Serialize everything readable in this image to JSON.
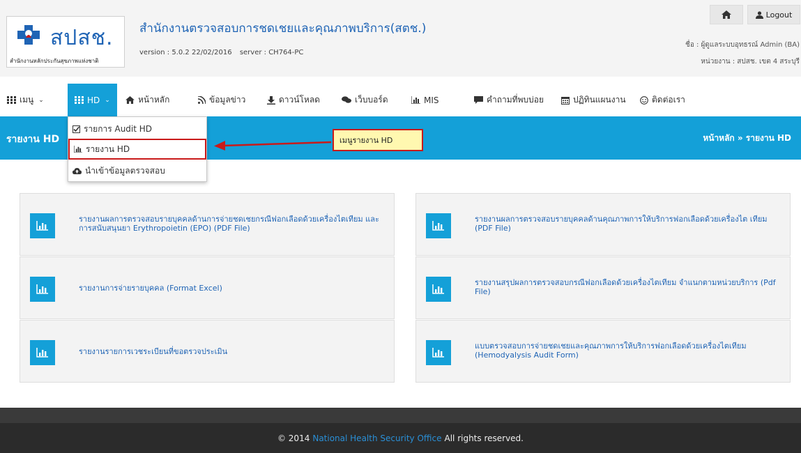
{
  "header": {
    "logo_text": "สปสช.",
    "logo_subtitle": "สำนักงานหลักประกันสุขภาพแห่งชาติ",
    "org_title": "สำนักงานตรวจสอบการชดเชยและคุณภาพบริการ(สตช.)",
    "version": "version : 5.0.2 22/02/2016",
    "server": "server : CH764-PC",
    "home_icon": "home-icon",
    "logout_label": "Logout",
    "user_name": "ชื่อ : ผู้ดูแลระบบอุทธรณ์ Admin (BA)",
    "user_unit": "หน่วยงาน : สปสช. เขต 4 สระบุรี"
  },
  "nav": {
    "items": [
      {
        "label": "เมนู",
        "icon": "grid-icon"
      },
      {
        "label": "HD",
        "icon": "grid-icon"
      },
      {
        "label": "หน้าหลัก",
        "icon": "home-icon"
      },
      {
        "label": "ข้อมูลข่าว",
        "icon": "rss-icon"
      },
      {
        "label": "ดาวน์โหลด",
        "icon": "download-icon"
      },
      {
        "label": "เว็บบอร์ด",
        "icon": "comments-icon"
      },
      {
        "label": "MIS",
        "icon": "bar-chart-icon"
      },
      {
        "label": "คำถามที่พบบ่อย",
        "icon": "comment-icon"
      },
      {
        "label": "ปฏิทินแผนงาน",
        "icon": "calendar-icon"
      },
      {
        "label": "ติดต่อเรา",
        "icon": "smile-icon"
      }
    ]
  },
  "page": {
    "title": "รายงาน HD",
    "breadcrumb": "หน้าหลัก » รายงาน HD"
  },
  "dropdown": {
    "items": [
      {
        "label": "รายการ Audit HD",
        "icon": "check-square-icon"
      },
      {
        "label": "รายงาน HD",
        "icon": "bar-chart-icon"
      },
      {
        "label": "นำเข้าข้อมูลตรวจสอบ",
        "icon": "cloud-upload-icon"
      }
    ]
  },
  "annotation": {
    "callout": "เมนูรายงาน HD"
  },
  "cards": [
    {
      "text": "รายงานผลการตรวจสอบรายบุคคลด้านการจ่ายชดเชยกรณีฟอกเลือดด้วยเครื่องไตเทียม และการสนับสนุนยา Erythropoietin (EPO) (PDF File)"
    },
    {
      "text": "รายงานผลการตรวจสอบรายบุคคลด้านคุณภาพการให้บริการฟอกเลือดด้วยเครื่องไต เทียม (PDF File)"
    },
    {
      "text": "รายงานการจ่ายรายบุคคล (Format Excel)"
    },
    {
      "text": "รายงานสรุปผลการตรวจสอบกรณีฟอกเลือดด้วยเครื่องไตเทียม จำแนกตามหน่วยบริการ (Pdf File)"
    },
    {
      "text": "รายงานรายการเวชระเบียนที่ขอตรวจประเมิน"
    },
    {
      "text": "แบบตรวจสอบการจ่ายชดเชยและคุณภาพการให้บริการฟอกเลือดด้วยเครื่องไตเทียม (Hemodyalysis Audit Form)"
    }
  ],
  "footer": {
    "copyright": "© 2014",
    "link": "National Health Security Office",
    "rights": "All rights reserved."
  },
  "colors": {
    "accent": "#14a0d8",
    "link": "#1f64b5",
    "highlight_border": "#c91a1a",
    "callout_bg": "#fff8b0"
  }
}
